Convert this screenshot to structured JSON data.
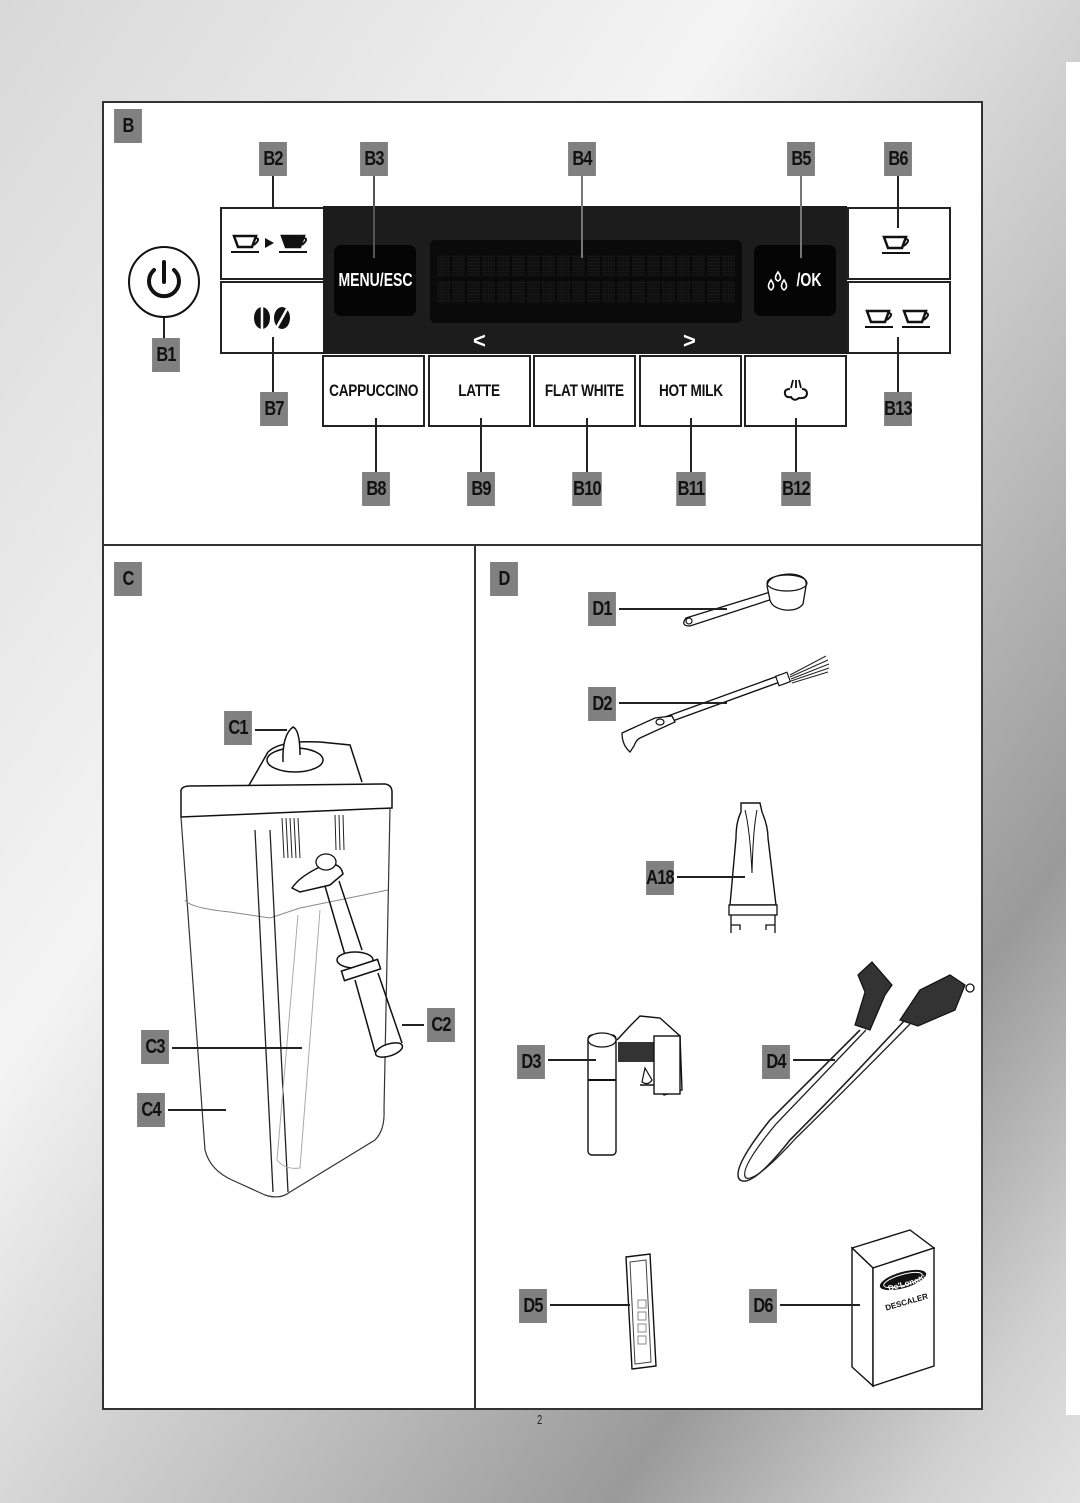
{
  "page_number": "2",
  "sections": {
    "b": {
      "tag": "B"
    },
    "c": {
      "tag": "C"
    },
    "d": {
      "tag": "D"
    }
  },
  "control_panel": {
    "labels": {
      "b1": "B1",
      "b2": "B2",
      "b3": "B3",
      "b4": "B4",
      "b5": "B5",
      "b6": "B6",
      "b7": "B7",
      "b8": "B8",
      "b9": "B9",
      "b10": "B10",
      "b11": "B11",
      "b12": "B12",
      "b13": "B13"
    },
    "buttons": {
      "power": {
        "icon": "power-icon"
      },
      "aroma_to_strong": {
        "icon": "cup-arrow-cup-icon"
      },
      "pre_ground": {
        "icon": "coffee-beans-icon"
      },
      "menu_esc": "MENU/ESC",
      "water_ok": "/OK",
      "one_cup": {
        "icon": "single-cup-icon"
      },
      "two_cups": {
        "icon": "double-cup-icon"
      },
      "cappuccino": "CAPPUCCINO",
      "latte": "LATTE",
      "flat_white": "FLAT WHITE",
      "hot_milk": "HOT MILK",
      "clean": {
        "icon": "steam-clean-icon"
      },
      "prev": "<",
      "next": ">"
    },
    "display": {
      "columns": 20,
      "rows": 2
    },
    "colors": {
      "panel": "#1c1c1c",
      "key": "#050505",
      "tag": "#808080"
    }
  },
  "milk_container": {
    "labels": {
      "c1": "C1",
      "c2": "C2",
      "c3": "C3",
      "c4": "C4"
    }
  },
  "accessories": {
    "labels": {
      "d1": "D1",
      "d2": "D2",
      "a18": "A18",
      "d3": "D3",
      "d4": "D4",
      "d5": "D5",
      "d6": "D6"
    },
    "descaler": {
      "brand": "De'Longhi",
      "product": "DESCALER"
    }
  }
}
